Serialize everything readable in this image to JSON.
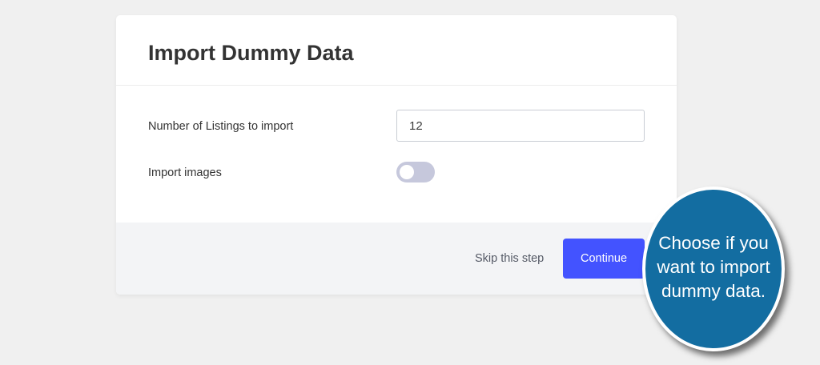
{
  "card": {
    "title": "Import Dummy Data"
  },
  "form": {
    "listings_label": "Number of Listings to import",
    "listings_value": "12",
    "images_label": "Import images",
    "images_enabled": false
  },
  "footer": {
    "skip_label": "Skip this step",
    "continue_label": "Continue"
  },
  "callout": {
    "text": "Choose if you want to import dummy data."
  },
  "colors": {
    "background": "#f0f0f0",
    "accent": "#4353ff",
    "toggle_off": "#c6c8dc",
    "callout": "#136da1"
  }
}
